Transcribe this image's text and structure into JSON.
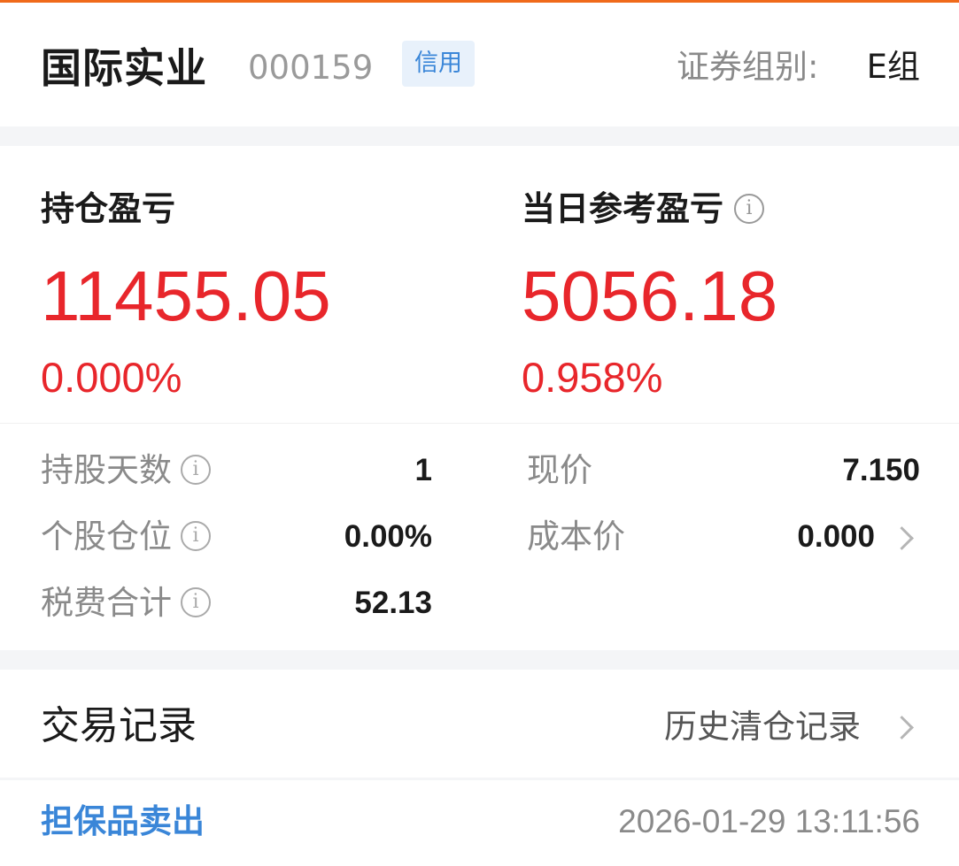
{
  "header": {
    "stock_name": "国际实业",
    "stock_code": "000159",
    "badge": "信用",
    "group_label": "证券组别:",
    "group_value": "E组"
  },
  "profit": {
    "position_title": "持仓盈亏",
    "position_value": "11455.05",
    "position_pct": "0.000%",
    "daily_title": "当日参考盈亏",
    "daily_value": "5056.18",
    "daily_pct": "0.958%",
    "info_glyph": "i"
  },
  "details": {
    "hold_days_label": "持股天数",
    "hold_days_value": "1",
    "position_ratio_label": "个股仓位",
    "position_ratio_value": "0.00%",
    "tax_fee_label": "税费合计",
    "tax_fee_value": "52.13",
    "current_price_label": "现价",
    "current_price_value": "7.150",
    "cost_price_label": "成本价",
    "cost_price_value": "0.000"
  },
  "trades": {
    "title": "交易记录",
    "history_link": "历史清仓记录",
    "rows": [
      {
        "type": "担保品卖出",
        "time": "2026-01-29 13:11:56"
      }
    ]
  },
  "colors": {
    "accent_orange": "#f06a1a",
    "profit_red": "#e8262b",
    "link_blue": "#3a86d8",
    "badge_bg": "#e8f1fb"
  },
  "icons": {
    "info": "info-circle-icon",
    "chevron": "chevron-right-icon"
  }
}
